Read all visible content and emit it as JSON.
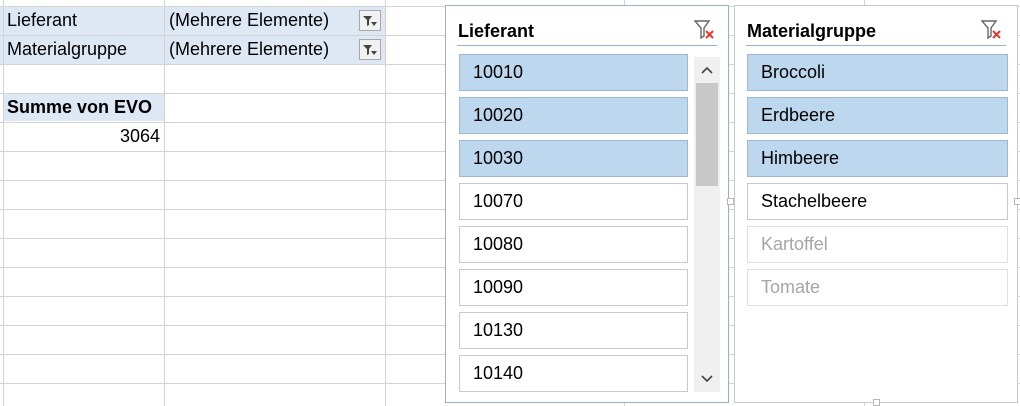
{
  "pivot": {
    "filters": [
      {
        "field": "Lieferant",
        "value": "(Mehrere Elemente)"
      },
      {
        "field": "Materialgruppe",
        "value": "(Mehrere Elemente)"
      }
    ],
    "sum_label": "Summe von EVO",
    "sum_value": "3064"
  },
  "slicer_lieferant": {
    "title": "Lieferant",
    "items": [
      {
        "label": "10010",
        "selected": true
      },
      {
        "label": "10020",
        "selected": true
      },
      {
        "label": "10030",
        "selected": true
      },
      {
        "label": "10070",
        "selected": false
      },
      {
        "label": "10080",
        "selected": false
      },
      {
        "label": "10090",
        "selected": false
      },
      {
        "label": "10130",
        "selected": false
      },
      {
        "label": "10140",
        "selected": false
      }
    ],
    "clear_icon": "clear-filter-icon"
  },
  "slicer_material": {
    "title": "Materialgruppe",
    "items": [
      {
        "label": "Broccoli",
        "selected": true
      },
      {
        "label": "Erdbeere",
        "selected": true
      },
      {
        "label": "Himbeere",
        "selected": true
      },
      {
        "label": "Stachelbeere",
        "selected": false
      },
      {
        "label": "Kartoffel",
        "selected": false,
        "no_data": true
      },
      {
        "label": "Tomate",
        "selected": false,
        "no_data": true
      }
    ],
    "clear_icon": "clear-filter-icon"
  },
  "colors": {
    "selected": "#bdd7ee",
    "header_band": "#dde8f4",
    "clear_x": "#e23b2e"
  }
}
